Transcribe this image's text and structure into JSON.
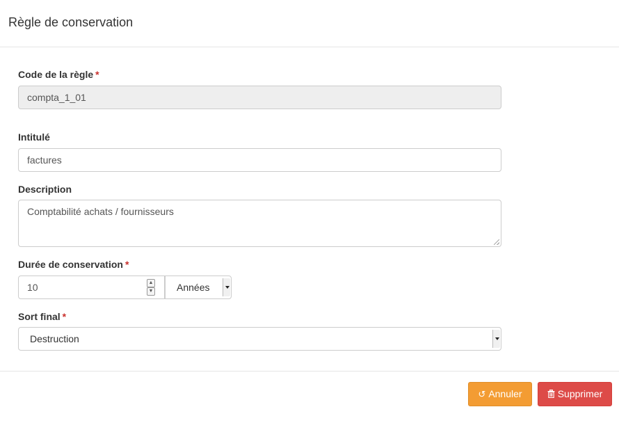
{
  "modal": {
    "title": "Règle de conservation"
  },
  "fields": {
    "code": {
      "label": "Code de la règle",
      "required_mark": "*",
      "value": "compta_1_01"
    },
    "title": {
      "label": "Intitulé",
      "value": "factures"
    },
    "description": {
      "label": "Description",
      "value": "Comptabilité achats / fournisseurs"
    },
    "duration": {
      "label": "Durée de conservation",
      "required_mark": "*",
      "value": "10",
      "unit": "Années"
    },
    "final_disposition": {
      "label": "Sort final",
      "required_mark": "*",
      "value": "Destruction"
    }
  },
  "buttons": {
    "cancel": {
      "label": "Annuler",
      "icon": "undo-icon",
      "color": "#f39c33"
    },
    "delete": {
      "label": "Supprimer",
      "icon": "trash-icon",
      "color": "#dd4b48"
    }
  }
}
